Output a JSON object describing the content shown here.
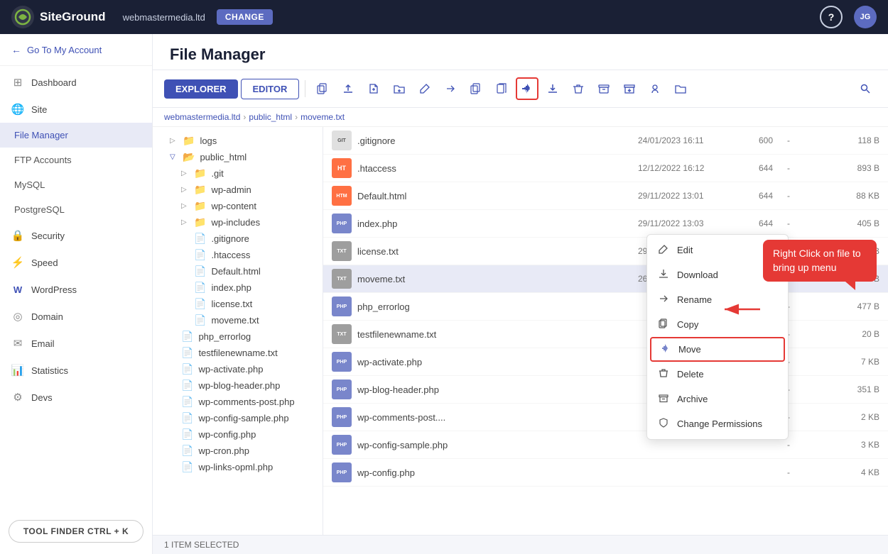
{
  "topbar": {
    "logo_text": "SiteGround",
    "domain": "webmastermedia.ltd",
    "change_label": "CHANGE",
    "help_label": "?",
    "avatar_label": "JG"
  },
  "sidebar": {
    "back_label": "Go To My Account",
    "items": [
      {
        "id": "dashboard",
        "label": "Dashboard",
        "icon": "⊞"
      },
      {
        "id": "site",
        "label": "Site",
        "icon": "🌐"
      },
      {
        "id": "file-manager",
        "label": "File Manager",
        "sub": true,
        "active": true
      },
      {
        "id": "ftp-accounts",
        "label": "FTP Accounts",
        "sub": true
      },
      {
        "id": "mysql",
        "label": "MySQL",
        "sub": true
      },
      {
        "id": "postgresql",
        "label": "PostgreSQL",
        "sub": true
      },
      {
        "id": "security",
        "label": "Security",
        "icon": "🔒"
      },
      {
        "id": "speed",
        "label": "Speed",
        "icon": "⚡"
      },
      {
        "id": "wordpress",
        "label": "WordPress",
        "icon": "W"
      },
      {
        "id": "domain",
        "label": "Domain",
        "icon": "◎"
      },
      {
        "id": "email",
        "label": "Email",
        "icon": "✉"
      },
      {
        "id": "statistics",
        "label": "Statistics",
        "icon": "📊"
      },
      {
        "id": "devs",
        "label": "Devs",
        "icon": "⚙"
      }
    ],
    "tool_finder_label": "TOOL FINDER CTRL + K"
  },
  "main": {
    "title": "File Manager"
  },
  "toolbar": {
    "tabs": [
      {
        "id": "explorer",
        "label": "EXPLORER",
        "active": true
      },
      {
        "id": "editor",
        "label": "EDITOR",
        "active": false
      }
    ],
    "buttons": [
      {
        "id": "copy-path",
        "title": "Copy path",
        "symbol": "⧉"
      },
      {
        "id": "upload",
        "title": "Upload",
        "symbol": "⬆"
      },
      {
        "id": "new-file",
        "title": "New file",
        "symbol": "📄"
      },
      {
        "id": "new-folder",
        "title": "New folder",
        "symbol": "📁"
      },
      {
        "id": "edit",
        "title": "Edit",
        "symbol": "✏"
      },
      {
        "id": "rename",
        "title": "Rename",
        "symbol": "↩"
      },
      {
        "id": "duplicate",
        "title": "Duplicate",
        "symbol": "⧉"
      },
      {
        "id": "copy",
        "title": "Copy",
        "symbol": "📋"
      },
      {
        "id": "move",
        "title": "Move",
        "symbol": "✛",
        "highlighted": true
      },
      {
        "id": "download",
        "title": "Download",
        "symbol": "⬇"
      },
      {
        "id": "delete",
        "title": "Delete",
        "symbol": "🗑"
      },
      {
        "id": "archive",
        "title": "Archive",
        "symbol": "📦"
      },
      {
        "id": "extract",
        "title": "Extract",
        "symbol": "📤"
      },
      {
        "id": "permissions",
        "title": "Permissions",
        "symbol": "🔑"
      },
      {
        "id": "new-folder2",
        "title": "New Folder",
        "symbol": "📂"
      },
      {
        "id": "search",
        "title": "Search",
        "symbol": "🔍"
      }
    ]
  },
  "breadcrumb": {
    "items": [
      "webmastermedia.ltd",
      "public_html",
      "moveme.txt"
    ]
  },
  "tree": {
    "items": [
      {
        "id": "logs",
        "label": "logs",
        "indent": 1,
        "expanded": false,
        "type": "folder"
      },
      {
        "id": "public_html",
        "label": "public_html",
        "indent": 1,
        "expanded": true,
        "type": "folder",
        "open": true
      },
      {
        "id": "git",
        "label": ".git",
        "indent": 2,
        "expanded": false,
        "type": "folder"
      },
      {
        "id": "wp-admin",
        "label": "wp-admin",
        "indent": 2,
        "expanded": false,
        "type": "folder"
      },
      {
        "id": "wp-content",
        "label": "wp-content",
        "indent": 2,
        "expanded": false,
        "type": "folder"
      },
      {
        "id": "wp-includes",
        "label": "wp-includes",
        "indent": 2,
        "expanded": false,
        "type": "folder"
      },
      {
        "id": "t-gitignore",
        "label": ".gitignore",
        "indent": 2,
        "type": "file"
      },
      {
        "id": "t-htaccess",
        "label": ".htaccess",
        "indent": 2,
        "type": "file"
      },
      {
        "id": "t-default",
        "label": "Default.html",
        "indent": 2,
        "type": "file"
      },
      {
        "id": "t-index",
        "label": "index.php",
        "indent": 2,
        "type": "file"
      },
      {
        "id": "t-license",
        "label": "license.txt",
        "indent": 2,
        "type": "file"
      },
      {
        "id": "t-moveme",
        "label": "moveme.txt",
        "indent": 2,
        "type": "file"
      },
      {
        "id": "t-phperrorlog",
        "label": "php_errorlog",
        "indent": 2,
        "type": "file"
      },
      {
        "id": "t-testfile",
        "label": "testfilenewname.txt",
        "indent": 2,
        "type": "file"
      },
      {
        "id": "t-wpactivate",
        "label": "wp-activate.php",
        "indent": 2,
        "type": "file"
      },
      {
        "id": "t-wpblog",
        "label": "wp-blog-header.php",
        "indent": 2,
        "type": "file"
      },
      {
        "id": "t-wpcomments",
        "label": "wp-comments-post.php",
        "indent": 2,
        "type": "file"
      },
      {
        "id": "t-wpconfigsample",
        "label": "wp-config-sample.php",
        "indent": 2,
        "type": "file"
      },
      {
        "id": "t-wpconfig",
        "label": "wp-config.php",
        "indent": 2,
        "type": "file"
      },
      {
        "id": "t-wpcron",
        "label": "wp-cron.php",
        "indent": 2,
        "type": "file"
      },
      {
        "id": "t-wplinks",
        "label": "wp-links-opml.php",
        "indent": 2,
        "type": "file"
      }
    ]
  },
  "filelist": {
    "rows": [
      {
        "id": "gitignore",
        "name": ".gitignore",
        "date": "24/01/2023 16:11",
        "perms": "600",
        "owner": "-",
        "size": "118 B",
        "type": "git"
      },
      {
        "id": "htaccess",
        "name": ".htaccess",
        "date": "12/12/2022 16:12",
        "perms": "644",
        "owner": "-",
        "size": "893 B",
        "type": "ht"
      },
      {
        "id": "default",
        "name": "Default.html",
        "date": "29/11/2022 13:01",
        "perms": "644",
        "owner": "-",
        "size": "88 KB",
        "type": "html"
      },
      {
        "id": "index",
        "name": "index.php",
        "date": "29/11/2022 13:03",
        "perms": "644",
        "owner": "-",
        "size": "405 B",
        "type": "php"
      },
      {
        "id": "license",
        "name": "license.txt",
        "date": "29/11/2022 13:03",
        "perms": "644",
        "owner": "-",
        "size": "19 KB",
        "type": "txt"
      },
      {
        "id": "moveme",
        "name": "moveme.txt",
        "date": "26/01/2023 10:40",
        "perms": "644",
        "owner": "-",
        "size": "0 B",
        "type": "txt",
        "selected": true
      },
      {
        "id": "phperrorlog",
        "name": "php_errorlog",
        "date": "",
        "perms": "",
        "owner": "-",
        "size": "477 B",
        "type": "php"
      },
      {
        "id": "testfile",
        "name": "testfilenewname.txt",
        "date": "",
        "perms": "",
        "owner": "-",
        "size": "20 B",
        "type": "txt"
      },
      {
        "id": "wpactivate",
        "name": "wp-activate.php",
        "date": "",
        "perms": "",
        "owner": "-",
        "size": "7 KB",
        "type": "php"
      },
      {
        "id": "wpblog",
        "name": "wp-blog-header.php",
        "date": "",
        "perms": "",
        "owner": "-",
        "size": "351 B",
        "type": "php"
      },
      {
        "id": "wpcomments",
        "name": "wp-comments-post....",
        "date": "",
        "perms": "",
        "owner": "-",
        "size": "2 KB",
        "type": "php"
      },
      {
        "id": "wpconfigsample",
        "name": "wp-config-sample.php",
        "date": "",
        "perms": "",
        "owner": "-",
        "size": "3 KB",
        "type": "php"
      },
      {
        "id": "wpconfig",
        "name": "wp-config.php",
        "date": "",
        "perms": "",
        "owner": "-",
        "size": "4 KB",
        "type": "php"
      }
    ]
  },
  "context_menu": {
    "items": [
      {
        "id": "edit",
        "label": "Edit",
        "icon": "✏"
      },
      {
        "id": "download",
        "label": "Download",
        "icon": "⬇"
      },
      {
        "id": "rename",
        "label": "Rename",
        "icon": "↩"
      },
      {
        "id": "copy",
        "label": "Copy",
        "icon": "📋"
      },
      {
        "id": "move",
        "label": "Move",
        "icon": "✛",
        "highlighted": true
      },
      {
        "id": "delete",
        "label": "Delete",
        "icon": "🗑"
      },
      {
        "id": "archive",
        "label": "Archive",
        "icon": "📦"
      },
      {
        "id": "permissions",
        "label": "Change Permissions",
        "icon": "💡"
      }
    ]
  },
  "tooltip": {
    "text": "Right Click on file to bring up menu"
  },
  "statusbar": {
    "text": "1 ITEM SELECTED"
  }
}
